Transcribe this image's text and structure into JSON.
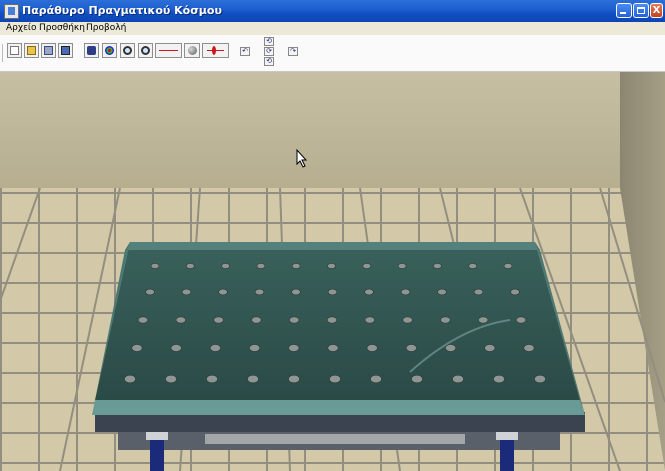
{
  "window": {
    "title": "Παράθυρο Πραγματικού Κόσμου",
    "controls": {
      "minimize": "_",
      "maximize": "□",
      "close": "X"
    }
  },
  "menu": {
    "items": [
      "Αρχείο",
      "Προσθήκη",
      "Προβολή"
    ]
  },
  "toolbar": {
    "buttons": [
      "new-file-icon",
      "open-file-icon",
      "save-icon",
      "save-image-icon",
      "camera-icon",
      "color-icon",
      "zoom-in-icon",
      "zoom-out-icon",
      "add-line-icon",
      "add-sphere-icon",
      "add-spring-icon"
    ],
    "navigation": [
      "rotate-up-icon",
      "rotate-left-icon",
      "reset-view-icon",
      "rotate-right-icon",
      "rotate-down-icon"
    ]
  },
  "scene": {
    "description_colors": {
      "wall": "#bfb89a",
      "floor_tile": "#d2c8a6",
      "grout": "#8e8c7e",
      "table": "#2f5550"
    },
    "hole_rows": 5,
    "holes_per_row": 11
  }
}
